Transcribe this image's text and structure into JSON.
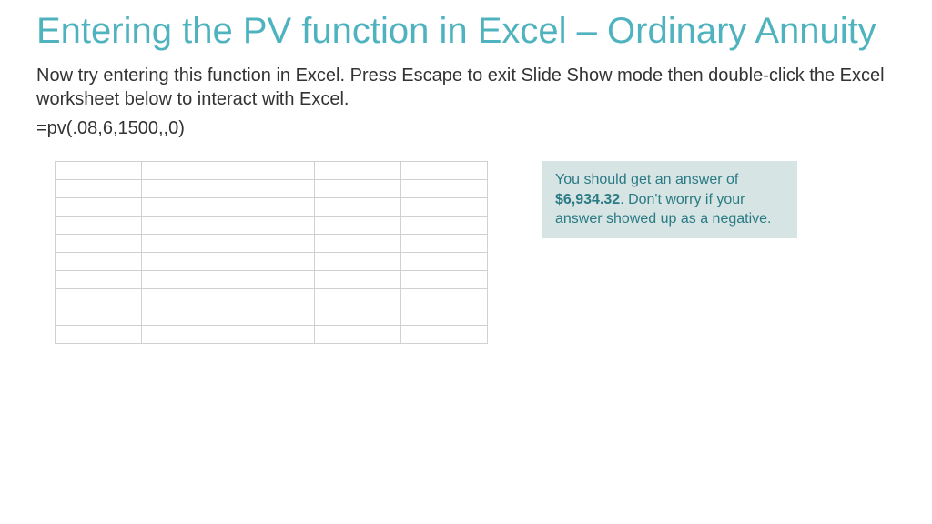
{
  "title": "Entering the PV function in Excel – Ordinary Annuity",
  "body": "Now try entering this function in Excel.  Press Escape to exit Slide Show mode then double-click the Excel worksheet below to interact with Excel.",
  "formula": "=pv(.08,6,1500,,0)",
  "callout": {
    "pre": "You should get an answer of ",
    "value": "$6,934.32",
    "post": ".  Don't worry if your answer showed up as a negative."
  },
  "table": {
    "rows": 10,
    "cols": 5
  }
}
